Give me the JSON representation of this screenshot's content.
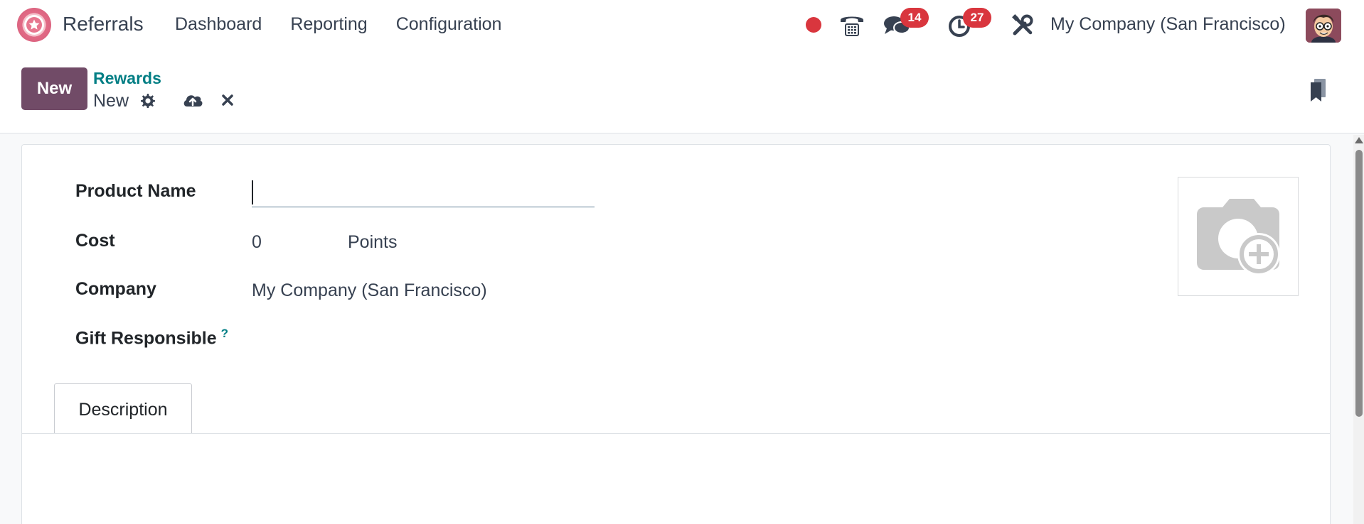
{
  "app": {
    "name": "Referrals"
  },
  "nav": {
    "items": [
      "Dashboard",
      "Reporting",
      "Configuration"
    ]
  },
  "systray": {
    "messages_count": "14",
    "activities_count": "27",
    "company": "My Company (San Francisco)"
  },
  "control_panel": {
    "new_label": "New",
    "breadcrumb_parent": "Rewards",
    "breadcrumb_current": "New"
  },
  "form": {
    "product_name_label": "Product Name",
    "product_name_value": "",
    "cost_label": "Cost",
    "cost_value": "0",
    "cost_unit": "Points",
    "company_label": "Company",
    "company_value": "My Company (San Francisco)",
    "gift_responsible_label": "Gift Responsible",
    "gift_responsible_help": "?"
  },
  "tabs": [
    "Description"
  ],
  "colors": {
    "brand": "#714b67",
    "link": "#017e84",
    "badge": "#d9363e"
  }
}
